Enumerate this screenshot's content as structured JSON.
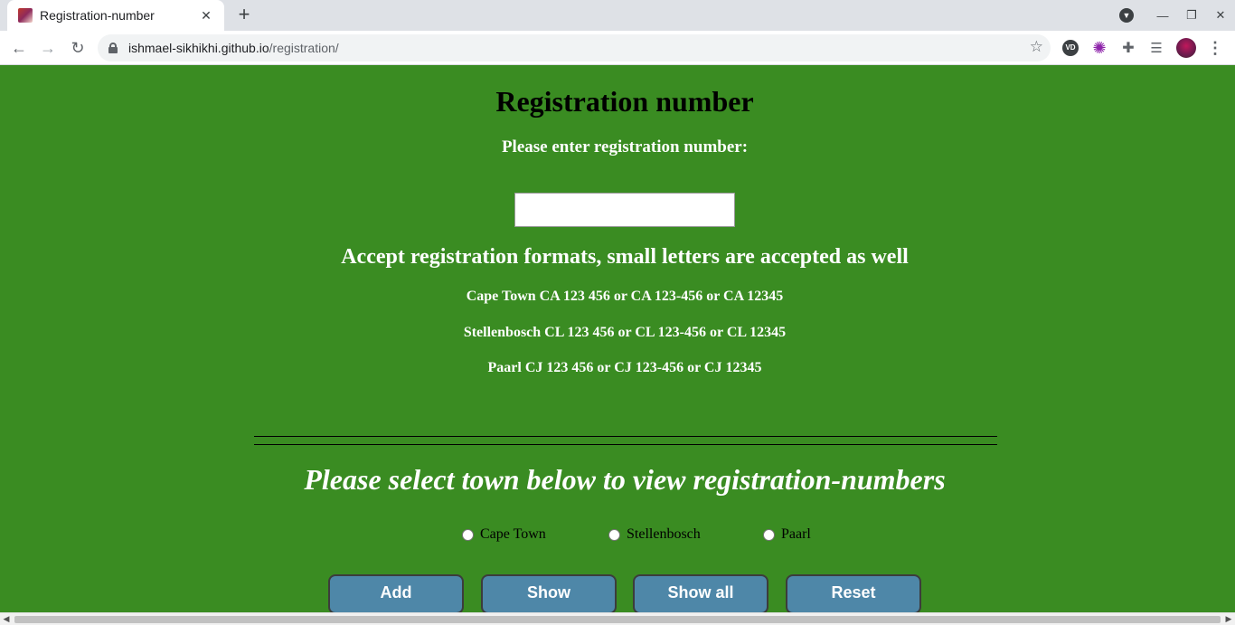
{
  "browser": {
    "tab_title": "Registration-number",
    "tab_close": "✕",
    "new_tab": "+",
    "url_host": "ishmael-sikhikhi.github.io",
    "url_path": "/registration/",
    "icons": [
      "favicon-icon",
      "back-arrow-icon",
      "forward-arrow-icon",
      "reload-icon",
      "lock-icon",
      "star-icon",
      "extension-vd-icon",
      "extension-flower-icon",
      "extensions-puzzle-icon",
      "media-list-icon",
      "profile-avatar-icon",
      "menu-dots-icon",
      "minimize-icon",
      "restore-icon",
      "close-window-icon"
    ]
  },
  "page": {
    "background_color": "#3a8c22",
    "title": "Registration number",
    "prompt": "Please enter registration number:",
    "input_value": "",
    "formats_heading": "Accept registration formats, small letters are accepted as well",
    "formats": [
      "Cape Town CA 123 456 or CA 123-456 or CA 12345",
      "Stellenbosch CL 123 456 or CL 123-456 or CL 12345",
      "Paarl CJ 123 456 or CJ 123-456 or CJ 12345"
    ],
    "select_heading": "Please select town below to view registration-numbers",
    "towns": [
      "Cape Town",
      "Stellenbosch",
      "Paarl"
    ],
    "buttons": {
      "add": "Add",
      "show": "Show",
      "show_all": "Show all",
      "reset": "Reset"
    },
    "button_color": "#4e87a8"
  }
}
